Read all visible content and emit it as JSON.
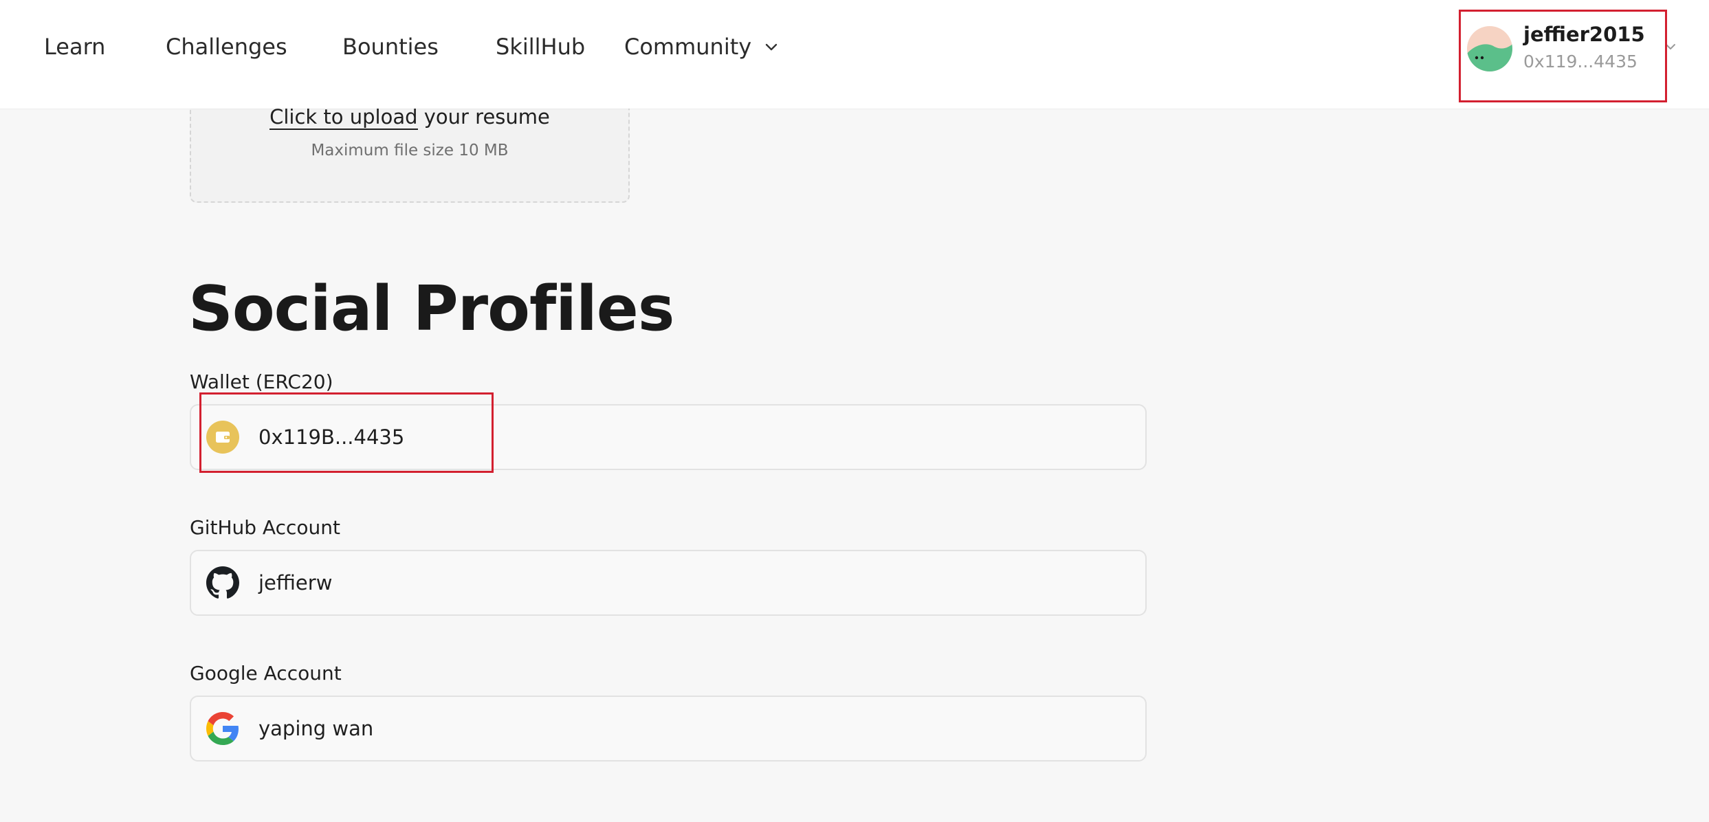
{
  "nav": {
    "items": [
      "Learn",
      "Challenges",
      "Bounties",
      "SkillHub"
    ],
    "community_label": "Community",
    "community_icon": "chevron-down-icon"
  },
  "user": {
    "name": "jeffier2015",
    "address": "0x119...4435",
    "avatar_icon": "avatar-icon",
    "menu_icon": "chevron-down-icon"
  },
  "upload": {
    "link_text": "Click to upload",
    "rest_text": " your resume",
    "hint": "Maximum file size 10 MB"
  },
  "social": {
    "title": "Social Profiles",
    "wallet": {
      "label": "Wallet (ERC20)",
      "value": "0x119B...4435",
      "icon": "wallet-icon"
    },
    "github": {
      "label": "GitHub Account",
      "value": "jeffierw",
      "icon": "github-icon"
    },
    "google": {
      "label": "Google Account",
      "value": "yaping wan",
      "icon": "google-icon"
    }
  },
  "colors": {
    "highlight": "#d32030",
    "wallet_icon_bg": "#e8c35a",
    "page_bg": "#f7f7f7"
  }
}
